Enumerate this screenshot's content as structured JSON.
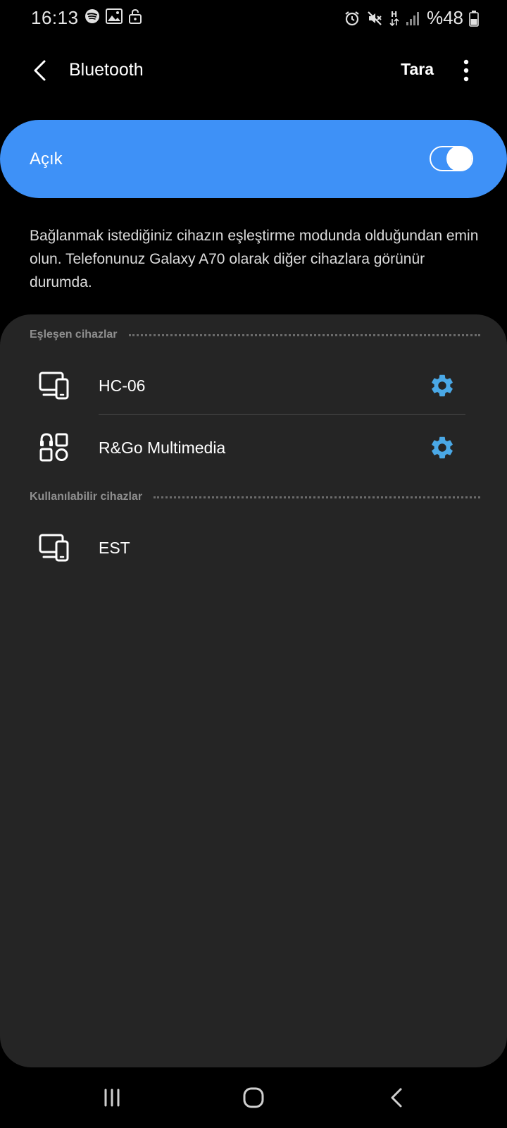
{
  "status_bar": {
    "time": "16:13",
    "battery": "%48",
    "left_icons": [
      "spotify-icon",
      "image-icon",
      "lock-icon"
    ],
    "right_icons": [
      "alarm-icon",
      "mute-icon",
      "network-h-icon",
      "signal-icon",
      "battery-icon"
    ]
  },
  "header": {
    "title": "Bluetooth",
    "scan_label": "Tara"
  },
  "toggle": {
    "label": "Açık",
    "state": "on",
    "color": "#3e91f7"
  },
  "description": "Bağlanmak istediğiniz cihazın eşleştirme modunda olduğundan emin olun. Telefonunuz Galaxy A70 olarak diğer cihazlara görünür durumda.",
  "paired": {
    "title": "Eşleşen cihazlar",
    "devices": [
      {
        "name": "HC-06",
        "icon": "phone-computer-icon"
      },
      {
        "name": "R&Go Multimedia",
        "icon": "multimedia-devices-icon"
      }
    ]
  },
  "available": {
    "title": "Kullanılabilir cihazlar",
    "devices": [
      {
        "name": "EST",
        "icon": "phone-computer-icon"
      }
    ]
  },
  "colors": {
    "gear": "#4aa8e6",
    "card_bg": "#252525",
    "background": "#000000"
  }
}
